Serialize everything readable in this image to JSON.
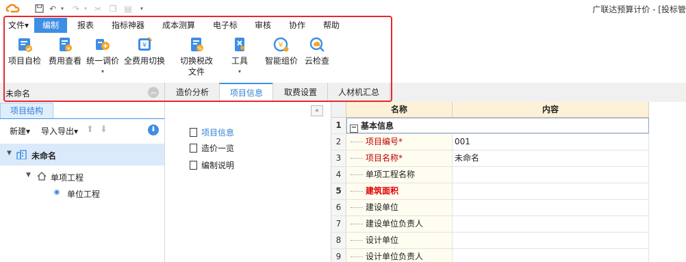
{
  "app": {
    "title": "广联达预算计价 - [投标管"
  },
  "menu": [
    "文件▾",
    "编制",
    "报表",
    "指标神器",
    "成本测算",
    "电子标",
    "审核",
    "协作",
    "帮助"
  ],
  "active_menu_index": 1,
  "ribbon": [
    {
      "label": "项目自检",
      "icon": "check-doc-icon"
    },
    {
      "label": "费用查看",
      "icon": "cost-view-icon"
    },
    {
      "label": "统一调价",
      "icon": "price-adjust-icon",
      "dropdown": true
    },
    {
      "label": "全费用切换",
      "icon": "full-cost-switch-icon"
    },
    {
      "label": "切换税改",
      "label2": "文件",
      "icon": "tax-switch-icon"
    },
    {
      "label": "工具",
      "icon": "tool-icon",
      "dropdown": true
    },
    {
      "label": "智能组价",
      "icon": "smart-price-icon"
    },
    {
      "label": "云检查",
      "icon": "cloud-check-icon"
    }
  ],
  "docbar": {
    "name": "未命名",
    "tabs": [
      "造价分析",
      "项目信息",
      "取费设置",
      "人材机汇总"
    ],
    "active_tab_index": 1
  },
  "left": {
    "tab": "项目结构",
    "tools": {
      "new": "新建▾",
      "import_export": "导入导出▾"
    },
    "tree": [
      {
        "label": "未命名",
        "level": 0,
        "selected": true
      },
      {
        "label": "单项工程",
        "level": 1
      },
      {
        "label": "单位工程",
        "level": 2
      }
    ]
  },
  "middle": {
    "items": [
      "项目信息",
      "造价一览",
      "编制说明"
    ],
    "active_index": 0
  },
  "grid": {
    "headers": [
      "名称",
      "内容"
    ],
    "group_label": "基本信息",
    "rows": [
      {
        "num": "2",
        "name": "项目编号",
        "value": "001",
        "required": true
      },
      {
        "num": "3",
        "name": "项目名称",
        "value": "未命名",
        "required": true
      },
      {
        "num": "4",
        "name": "单项工程名称",
        "value": ""
      },
      {
        "num": "5",
        "name": "建筑面积",
        "value": "",
        "emphasis": true
      },
      {
        "num": "6",
        "name": "建设单位",
        "value": ""
      },
      {
        "num": "7",
        "name": "建设单位负责人",
        "value": ""
      },
      {
        "num": "8",
        "name": "设计单位",
        "value": ""
      },
      {
        "num": "9",
        "name": "设计单位负责人",
        "value": ""
      }
    ]
  },
  "colors": {
    "accent": "#3d8ee4",
    "highlight_frame": "#e8252b"
  }
}
